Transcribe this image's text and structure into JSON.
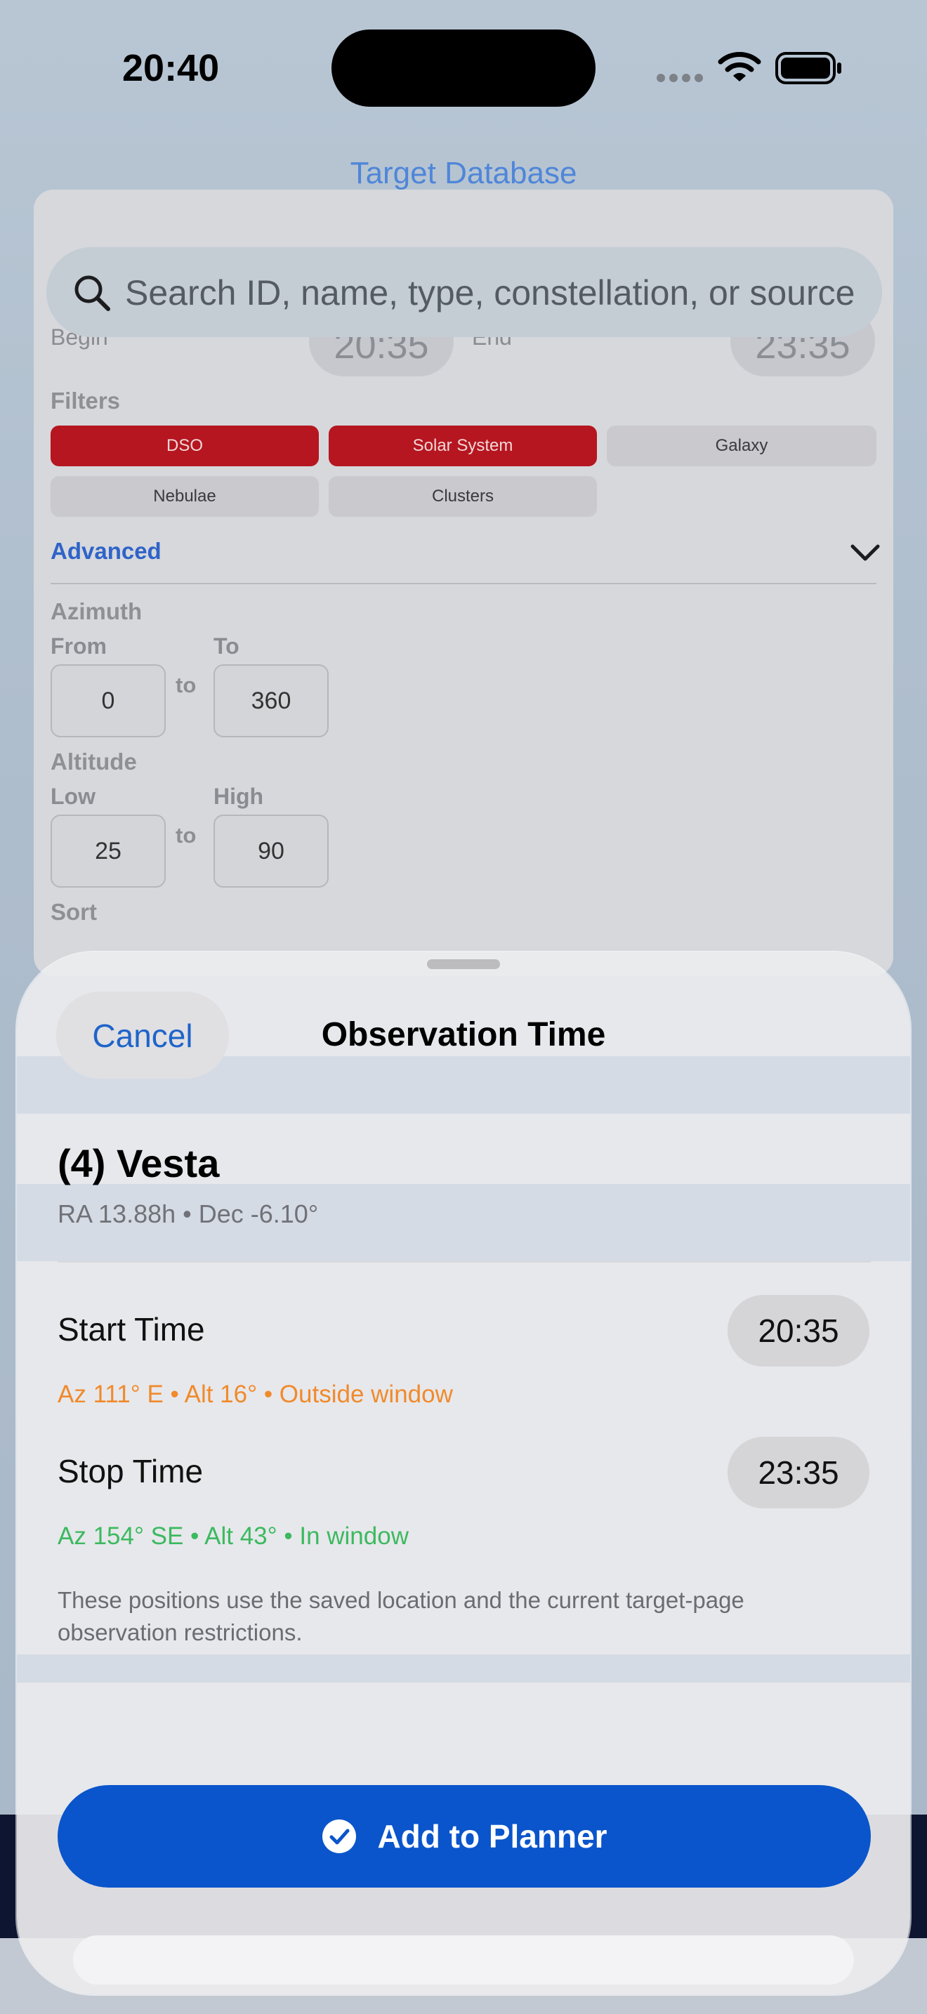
{
  "status_bar": {
    "time": "20:40"
  },
  "background": {
    "title": "Target Database",
    "search_placeholder": "Search ID, name, type, constellation, or source",
    "begin_label": "Begin",
    "begin_time": "20:35",
    "end_label": "End",
    "end_time": "23:35",
    "filters_label": "Filters",
    "filters": [
      {
        "label": "DSO",
        "active": true
      },
      {
        "label": "Solar System",
        "active": true
      },
      {
        "label": "Galaxy",
        "active": false
      },
      {
        "label": "Nebulae",
        "active": false
      },
      {
        "label": "Clusters",
        "active": false
      }
    ],
    "advanced_label": "Advanced",
    "azimuth": {
      "label": "Azimuth",
      "from_label": "From",
      "to_label": "To",
      "from": "0",
      "to": "360",
      "sep": "to"
    },
    "altitude": {
      "label": "Altitude",
      "low_label": "Low",
      "high_label": "High",
      "low": "25",
      "high": "90",
      "sep": "to"
    },
    "sort_label": "Sort"
  },
  "sheet": {
    "cancel_label": "Cancel",
    "title": "Observation Time",
    "target_name": "(4) Vesta",
    "target_coords": "RA 13.88h • Dec -6.10°",
    "start_label": "Start Time",
    "start_time": "20:35",
    "start_status": "Az 111° E • Alt 16° • Outside window",
    "stop_label": "Stop Time",
    "stop_time": "23:35",
    "stop_status": "Az 154° SE • Alt 43° • In window",
    "note": "These positions use the saved location and the current target-page observation restrictions.",
    "add_label": "Add to Planner"
  },
  "colors": {
    "accent": "#0a55cb",
    "filter_active": "#b51620",
    "status_outside": "#f08a2c",
    "status_inside": "#3cb960"
  }
}
